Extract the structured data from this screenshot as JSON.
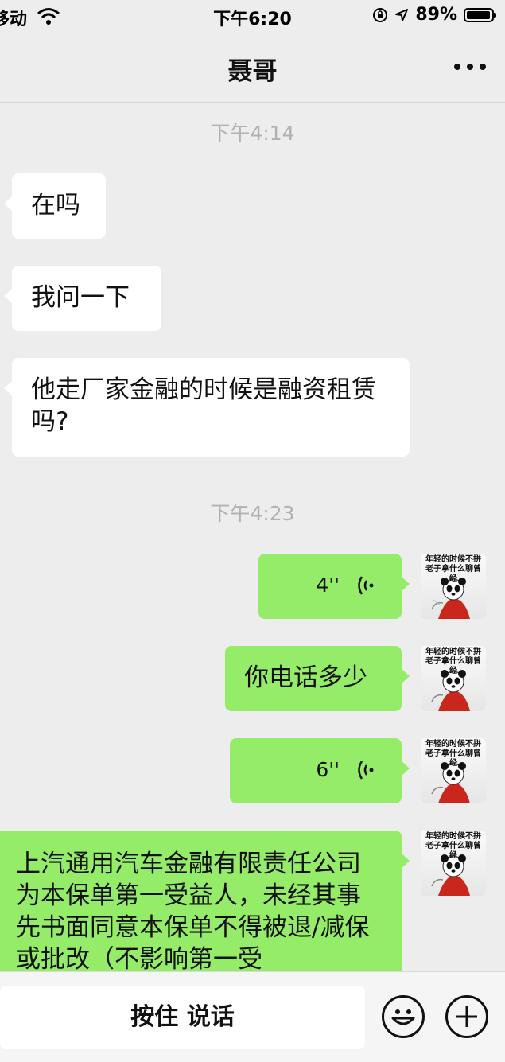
{
  "status_bar": {
    "carrier": "移动",
    "time": "下午6:20",
    "battery": "89%",
    "battery_level": 0.89
  },
  "header": {
    "title": "聂哥",
    "more_icon": "more-icon"
  },
  "messages": {
    "timestamp_1": "下午4:14",
    "m1": "在吗",
    "m2": "我问一下",
    "m3": "他走厂家金融的时候是融资租赁吗?",
    "timestamp_2": "下午4:23",
    "m4_duration": "4''",
    "m5": "你电话多少",
    "m6_duration": "6''",
    "m7": "上汽通用汽车金融有限责任公司为本保单第一受益人，未经其事先书面同意本保单不得被退/减保或批改（不影响第一受"
  },
  "avatar": {
    "caption": "年轻的时候不拼老子拿什么聊曾经"
  },
  "input_bar": {
    "hold_to_talk": "按住 说话"
  },
  "colors": {
    "background": "#ededed",
    "outgoing_bubble": "#95ec69",
    "incoming_bubble": "#ffffff",
    "timestamp": "#b2b2b2"
  }
}
